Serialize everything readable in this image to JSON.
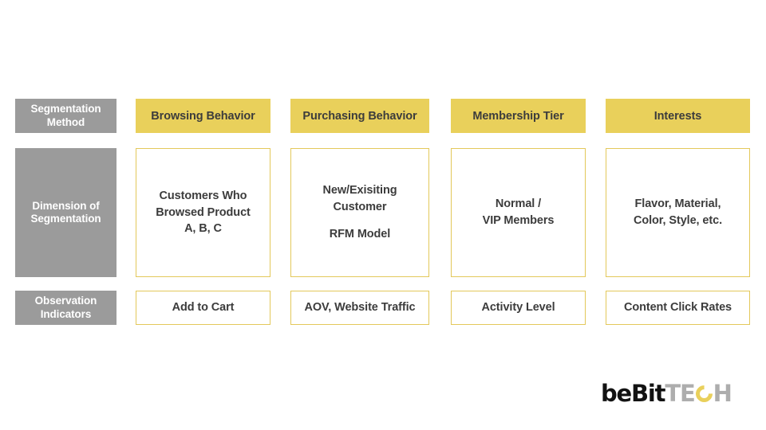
{
  "slide": {
    "background_color": "#ffffff",
    "accent_yellow": "#e9d05b",
    "label_gray": "#9b9b9b",
    "text_dark": "#3c3c3c"
  },
  "matrix": {
    "row_labels": [
      "Segmentation\nMethod",
      "Dimension of\nSegmentation",
      "Observation\nIndicators"
    ],
    "row_labels_flat": {
      "segmentation_method_line1": "Segmentation",
      "segmentation_method_line2": "Method",
      "dimension_line1": "Dimension of",
      "dimension_line2": "Segmentation",
      "observation_line1": "Observation",
      "observation_line2": "Indicators"
    },
    "columns": [
      {
        "header": "Browsing Behavior",
        "dimension_lines": [
          "Customers Who",
          "Browsed Product",
          "A, B, C"
        ],
        "dimension_extra": "",
        "indicator": "Add to Cart"
      },
      {
        "header": "Purchasing Behavior",
        "dimension_lines": [
          "New/Exisiting",
          "Customer"
        ],
        "dimension_extra": "RFM Model",
        "indicator": "AOV, Website Traffic"
      },
      {
        "header": "Membership Tier",
        "dimension_lines": [
          "Normal /",
          "VIP Members"
        ],
        "dimension_extra": "",
        "indicator": "Activity Level"
      },
      {
        "header": "Interests",
        "dimension_lines": [
          "Flavor, Material,",
          "Color, Style, etc."
        ],
        "dimension_extra": "",
        "indicator": "Content Click Rates"
      }
    ]
  },
  "logo": {
    "part_be": "beBit",
    "part_t": "T",
    "part_e": "E",
    "part_c": "C",
    "part_h": "H",
    "brand_black": "#121212",
    "brand_gray": "#adadad",
    "brand_yellow": "#e9d05b"
  }
}
